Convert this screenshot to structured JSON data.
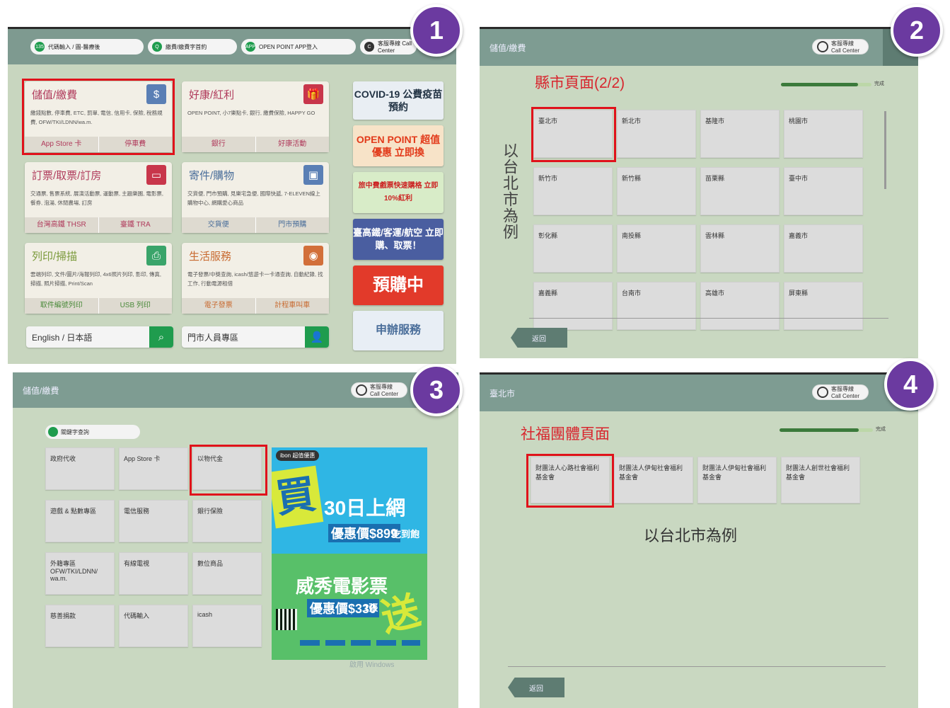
{
  "steps": [
    "1",
    "2",
    "3",
    "4"
  ],
  "panel1": {
    "nav": [
      {
        "icon": "135",
        "label": "代碼輸入 / 圖-醫療後"
      },
      {
        "icon": "Q",
        "label": "繳費/繳費字首約"
      },
      {
        "icon": "APP",
        "label": "OPEN POINT APP登入"
      },
      {
        "icon": "C",
        "label": "客服專線 Call Center"
      }
    ],
    "cards": [
      {
        "title": "儲值/繳費",
        "icon": "$",
        "desc": "繳錢點數, 停車費, ETC, 罰單, 電信, 信用卡, 保險, 稅務規費, OFW/TKI/LDNN/wa.m.",
        "buttons": [
          "App Store 卡",
          "停車費"
        ]
      },
      {
        "title": "好康/紅利",
        "icon": "🎁",
        "desc": "OPEN POINT, 小7樂點卡, 銀行, 繳費保險, HAPPY GO",
        "buttons": [
          "銀行",
          "好康活動"
        ]
      },
      {
        "title": "訂票/取票/訂房",
        "icon": "▭",
        "desc": "交通票, 售票系統, 展演活動票, 運動票, 主題樂園, 電影票, 餐券, 泡湯, 休閒農場, 訂房",
        "buttons": [
          "台灣高鐵 THSR",
          "臺鐵 TRA"
        ]
      },
      {
        "title": "寄件/購物",
        "icon": "▣",
        "desc": "交貨便, 門市預購, 見樂宅急便, 國際快遞, 7-ELEVEN線上購物中心, 網購愛心商品",
        "buttons": [
          "交貨便",
          "門市預購"
        ]
      },
      {
        "title": "列印/掃描",
        "icon": "⎙",
        "desc": "雲端列印, 文件/圖片/海報列印, 4x6照片列印, 影印, 傳真, 掃描, 照片掃描, Print/Scan",
        "buttons": [
          "取件編號列印",
          "USB 列印"
        ]
      },
      {
        "title": "生活服務",
        "icon": "◉",
        "desc": "電子發票/中獎查詢, icash/悠遊卡一卡通查詢, 自動紀錄, 找工作, 行動電源租借",
        "buttons": [
          "電子發票",
          "計程車叫車"
        ]
      }
    ],
    "search": {
      "label": "English / 日本語",
      "icon": "search-icon"
    },
    "member": {
      "label": "門市人員專區",
      "icon": "person-icon"
    },
    "banners": [
      "COVID-19 公費疫苗預約",
      "OPEN POINT 超值優惠 立即換",
      "旅中費戲票快速購格 立即10%紅利",
      "臺高鐵/客運/航空 立即購、取票！",
      "預購中",
      "申辦服務"
    ]
  },
  "panel2": {
    "topbar": "儲值/繳費",
    "pill": "客服專線 Call Center",
    "title": "縣市頁面(2/2)",
    "progress_label": "完成",
    "progress": 0.85,
    "side_note": "以台北市為例",
    "cities": [
      "臺北市",
      "新北市",
      "基隆市",
      "桃園市",
      "新竹市",
      "新竹縣",
      "苗栗縣",
      "臺中市",
      "彰化縣",
      "南投縣",
      "雲林縣",
      "嘉義市",
      "嘉義縣",
      "台南市",
      "高雄市",
      "屏東縣"
    ],
    "back": "返回"
  },
  "panel3": {
    "topbar": "儲值/繳費",
    "pill": "客服專線 Call Center",
    "search_chip": "關鍵字查詢",
    "tiles": [
      "政府代收",
      "App Store 卡",
      "以物代金",
      "遊戲 & 點數專區",
      "電信服務",
      "銀行保險",
      "外籍專區 OFW/TKI/LDNN/ wa.m.",
      "有線電視",
      "數位商品",
      "慈善捐款",
      "代碼輸入",
      "icash"
    ],
    "ad": {
      "badge": "ibon 超值優惠",
      "big1": "買",
      "line1": "30日上網",
      "price1": "優惠價$899",
      "price1_suffix": "吃到飽",
      "line2": "威秀電影票",
      "price2": "優惠價$330",
      "count2": "1張",
      "big2": "送"
    },
    "watermark": "啟用 Windows"
  },
  "panel4": {
    "topbar": "臺北市",
    "pill": "客服專線 Call Center",
    "title": "社福團體頁面",
    "progress_label": "完成",
    "progress": 0.85,
    "orgs": [
      "財團法人心路社會福利基金會",
      "財團法人伊甸社會福利基金會",
      "財團法人伊甸社會福利基金會",
      "財團法人創世社會福利基金會"
    ],
    "note": "以台北市為例",
    "back": "返回"
  }
}
